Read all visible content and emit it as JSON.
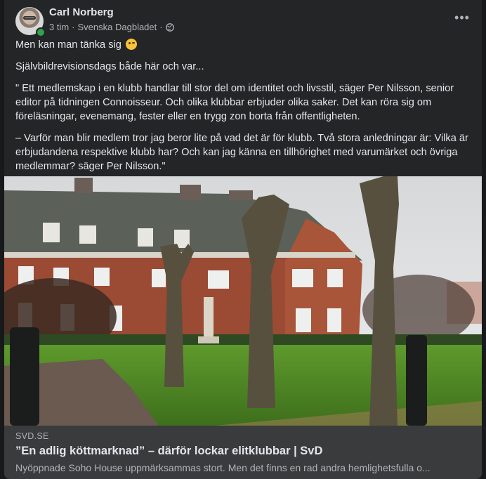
{
  "post": {
    "author": "Carl Norberg",
    "time": "3 tim",
    "separator": "·",
    "source": "Svenska Dagbladet",
    "separator2": "·",
    "privacy_icon": "globe-icon",
    "more_icon": "more-options-icon",
    "more_label": "•••",
    "emoji_icon": "winking-face-emoji",
    "lines": {
      "line1": "Men kan man tänka sig",
      "line2": "Självbildrevisionsdags både här och var...",
      "para1": "\" Ett medlemskap i en klubb handlar till stor del om identitet och livsstil, säger Per Nilsson, senior editor på tidningen Connoisseur. Och olika klubbar erbjuder olika saker. Det kan röra sig om föreläsningar, evenemang, fester eller en trygg zon borta från offentligheten.",
      "para2": "– Varför man blir medlem tror jag beror lite på vad det är för klubb. Två stora anledningar är: Vilka är erbjudandena respektive klubb har? Och kan jag känna en tillhörighet med varumärket och övriga medlemmar? säger Per Nilsson.\""
    }
  },
  "link": {
    "domain": "SVD.SE",
    "title": "”En adlig köttmarknad” – därför lockar elitklubbar | SvD",
    "description": "Nyöppnade Soho House uppmärksammas stort. Men det finns en rad andra hemlighetsfulla o..."
  },
  "colors": {
    "card_bg": "#242526",
    "link_info_bg": "#3a3b3c",
    "text_primary": "#e4e6eb",
    "text_secondary": "#b0b3b8",
    "online": "#31a24c"
  }
}
